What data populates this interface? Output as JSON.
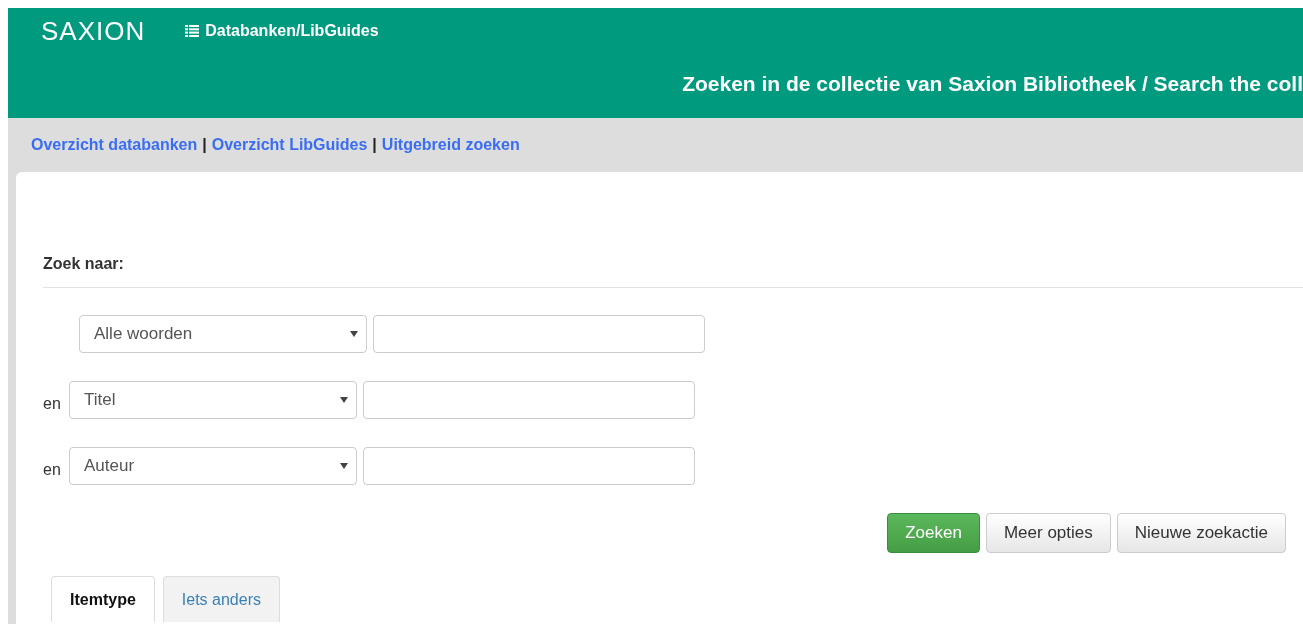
{
  "header": {
    "logo": "SAXION",
    "menu_link": "Databanken/LibGuides",
    "title": "Zoeken in de collectie van Saxion Bibliotheek / Search the coll"
  },
  "nav_links": [
    {
      "label": "Overzicht databanken"
    },
    {
      "label": "Overzicht LibGuides"
    },
    {
      "label": "Uitgebreid zoeken"
    }
  ],
  "nav_separator": "|",
  "search": {
    "heading": "Zoek naar:",
    "rows": [
      {
        "select": "Alle woorden"
      },
      {
        "connector": "en",
        "select": "Titel"
      },
      {
        "connector": "en",
        "select": "Auteur"
      }
    ],
    "buttons": [
      {
        "label": "Zoeken",
        "kind": "primary"
      },
      {
        "label": "Meer opties",
        "kind": "default"
      },
      {
        "label": "Nieuwe zoekactie",
        "kind": "default"
      }
    ]
  },
  "tabs": [
    {
      "label": "Itemtype",
      "selected": true
    },
    {
      "label": "Iets anders",
      "selected": false
    }
  ]
}
